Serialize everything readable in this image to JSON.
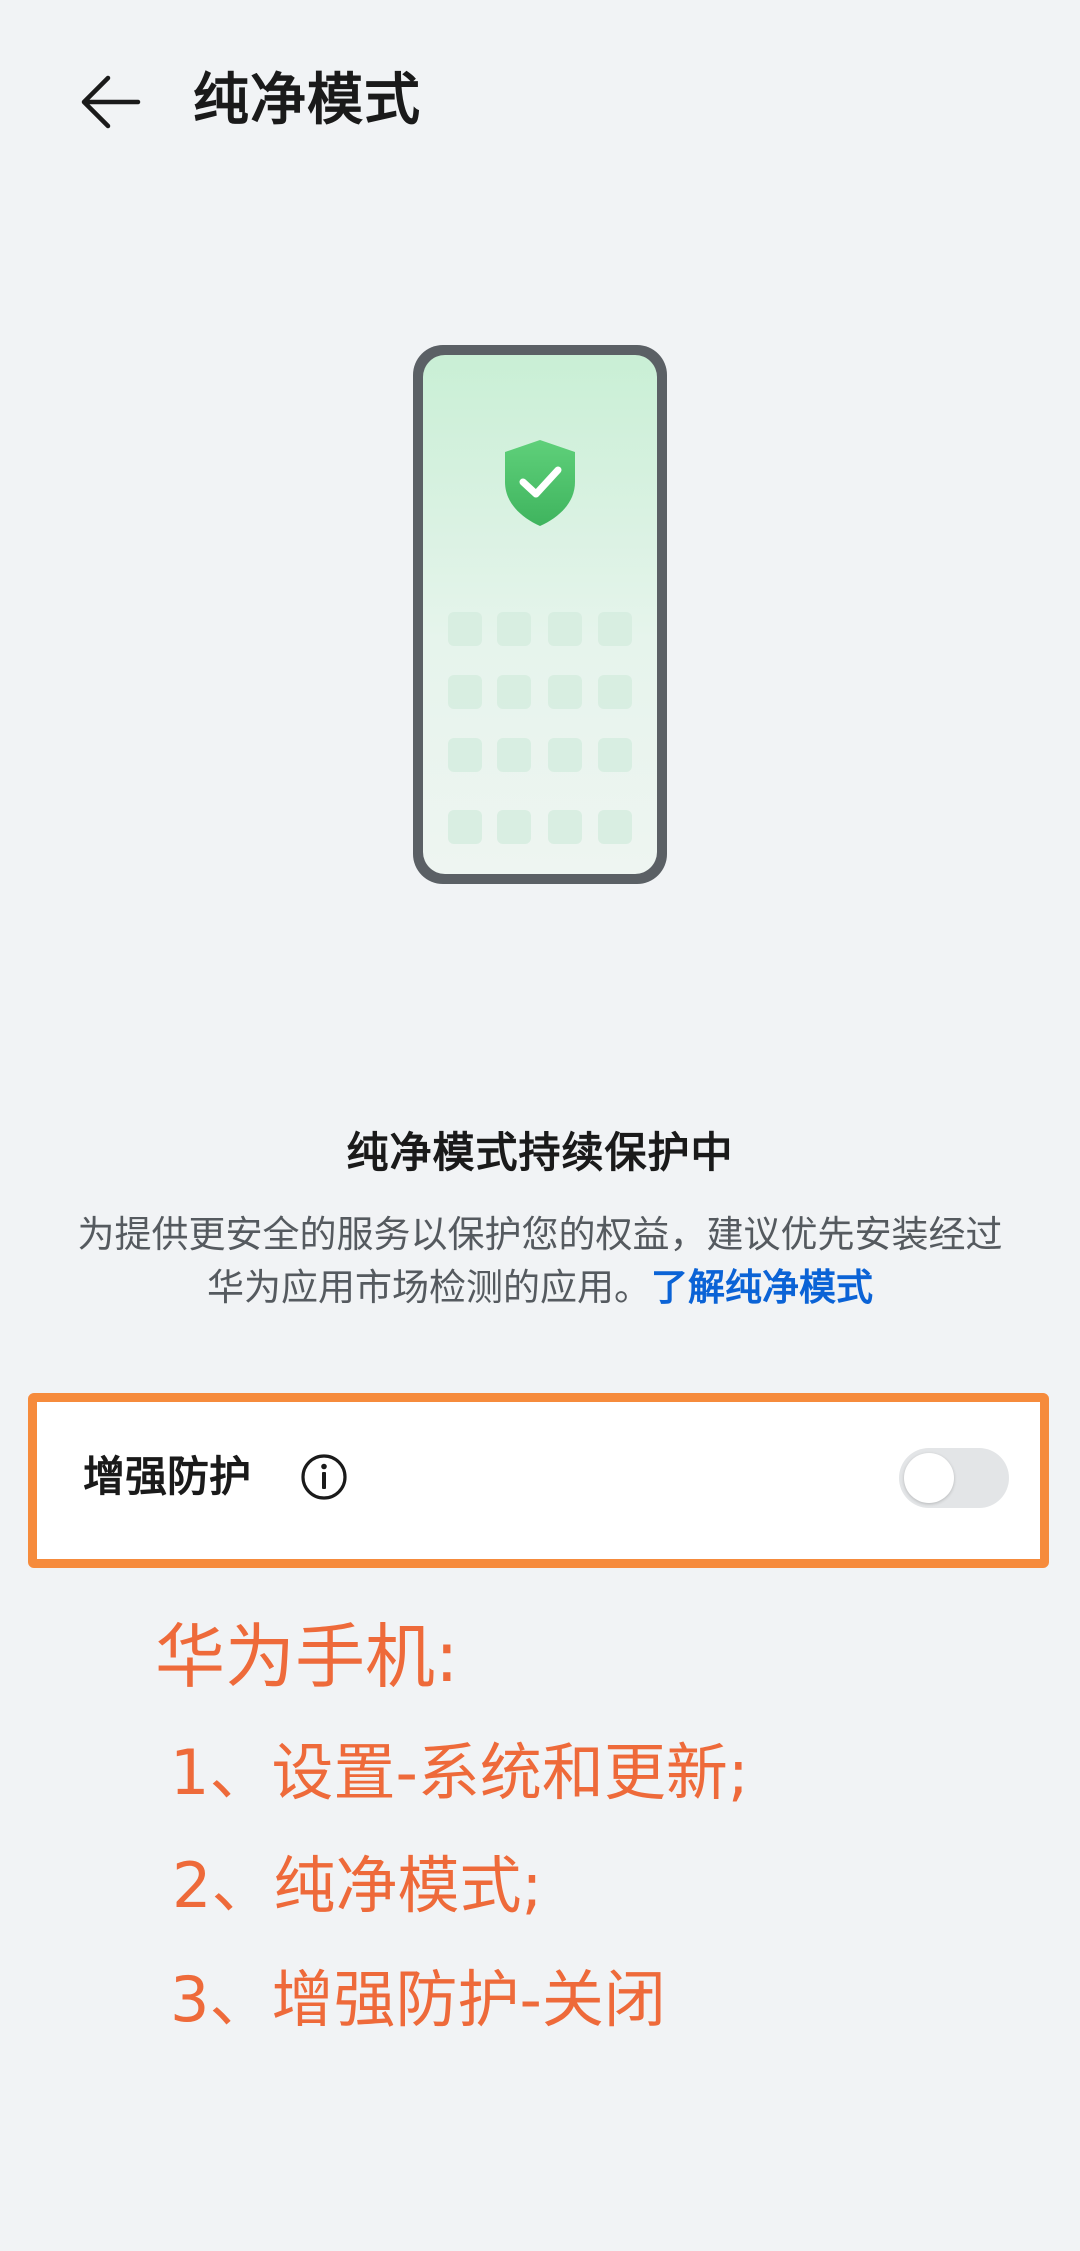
{
  "header": {
    "title": "纯净模式",
    "back_icon": "arrow-left-icon"
  },
  "illustration": {
    "icon": "shield-check-icon",
    "shield_color": "#4cc26a",
    "screen_gradient_top": "#c9efd5",
    "screen_gradient_bottom": "#eaf4ee",
    "frame_color": "#5b6065"
  },
  "status": {
    "title": "纯净模式持续保护中",
    "description": "为提供更安全的服务以保护您的权益，建议优先安装经过华为应用市场检测的应用。",
    "learn_more": "了解纯净模式"
  },
  "enhanced_protection": {
    "label": "增强防护",
    "info_icon": "info-icon",
    "enabled": false
  },
  "annotation": {
    "title": "华为手机:",
    "steps": [
      "1、设置-系统和更新;",
      "2、纯净模式;",
      "3、增强防护-关闭"
    ],
    "color": "#ee6a3a",
    "highlight_border_color": "#f68b3c"
  }
}
